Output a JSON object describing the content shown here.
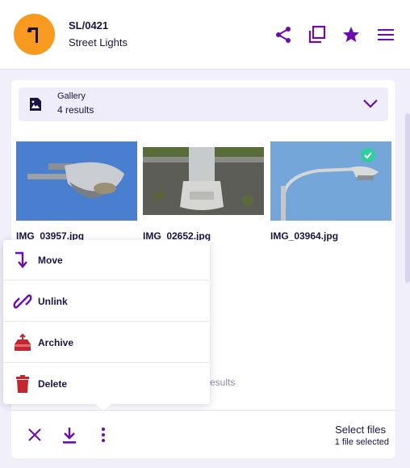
{
  "header": {
    "asset_code": "SL/0421",
    "asset_type": "Street Lights",
    "avatar_icon": "street-light-icon",
    "actions": [
      "share-icon",
      "duplicate-icon",
      "star-icon",
      "menu-icon"
    ]
  },
  "gallery": {
    "title": "Gallery",
    "count": "4 results",
    "icon": "image-icon",
    "items": [
      {
        "filename": "IMG_03957.jpg",
        "selected": false
      },
      {
        "filename": "IMG_02652.jpg",
        "selected": false
      },
      {
        "filename": "IMG_03964.jpg",
        "selected": true
      }
    ],
    "results_ghost": "results"
  },
  "context_menu": {
    "items": [
      {
        "label": "Move",
        "icon": "move-arrow-icon"
      },
      {
        "label": "Unlink",
        "icon": "unlink-icon"
      },
      {
        "label": "Archive",
        "icon": "archive-icon"
      },
      {
        "label": "Delete",
        "icon": "trash-icon"
      }
    ]
  },
  "footer": {
    "title": "Select files",
    "subtitle": "1 file selected"
  },
  "colors": {
    "brand": "#6a0dad",
    "avatar": "#f79a1f",
    "check": "#2ecf9d",
    "danger": "#c0282f"
  }
}
